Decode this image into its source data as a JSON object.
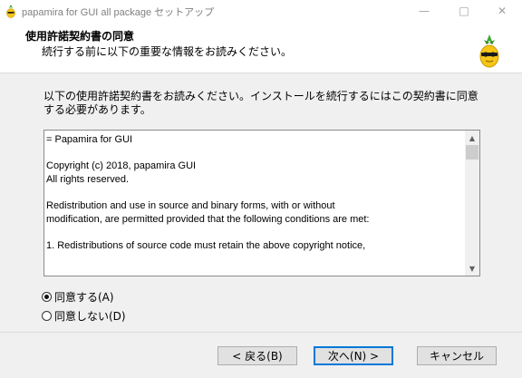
{
  "window": {
    "title": "papamira for GUI all package セットアップ",
    "controls": {
      "minimize": "—",
      "maximize": "□",
      "close": "✕"
    }
  },
  "header": {
    "title": "使用許諾契約書の同意",
    "subtitle": "続行する前に以下の重要な情報をお読みください。",
    "logo_icon": "pineapple-icon"
  },
  "content": {
    "instruction": "以下の使用許諾契約書をお読みください。インストールを続行するにはこの契約書に同意する必要があります。",
    "license_text": "= Papamira for GUI\n\nCopyright (c) 2018, papamira GUI\nAll rights reserved.\n\nRedistribution and use in source and binary forms, with or without\nmodification, are permitted provided that the following conditions are met:\n\n1. Redistributions of source code must retain the above copyright notice,",
    "scroll_up": "▲",
    "scroll_down": "▼",
    "accept_label": "同意する(A)",
    "decline_label": "同意しない(D)",
    "accept_selected": true
  },
  "footer": {
    "back_label": "< 戻る(B)",
    "next_label": "次へ(N) >",
    "cancel_label": "キャンセル"
  },
  "colors": {
    "accent": "#0078d7",
    "panel": "#f0f0f0",
    "pineapple_body": "#f5c518",
    "pineapple_leaves": "#3fa535"
  }
}
